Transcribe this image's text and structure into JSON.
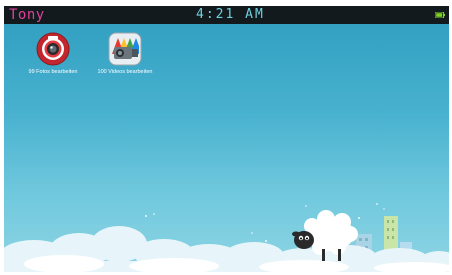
{
  "status_bar": {
    "user_name": "Tony",
    "time": "4:21 AM",
    "battery_icon": "battery-icon"
  },
  "desktop": {
    "icons": [
      {
        "label": "99 Fotos bearbeiten",
        "icon": "camera-icon"
      },
      {
        "label": "100 Videos bearbeiten",
        "icon": "video-camera-icon"
      }
    ]
  },
  "colors": {
    "status_bar_bg": "#121a1d",
    "user_name": "#e0409a",
    "clock": "#6fd0e0",
    "sky_top": "#2f9dbf",
    "sky_bottom": "#8ed5e4",
    "battery": "#7ed321"
  }
}
